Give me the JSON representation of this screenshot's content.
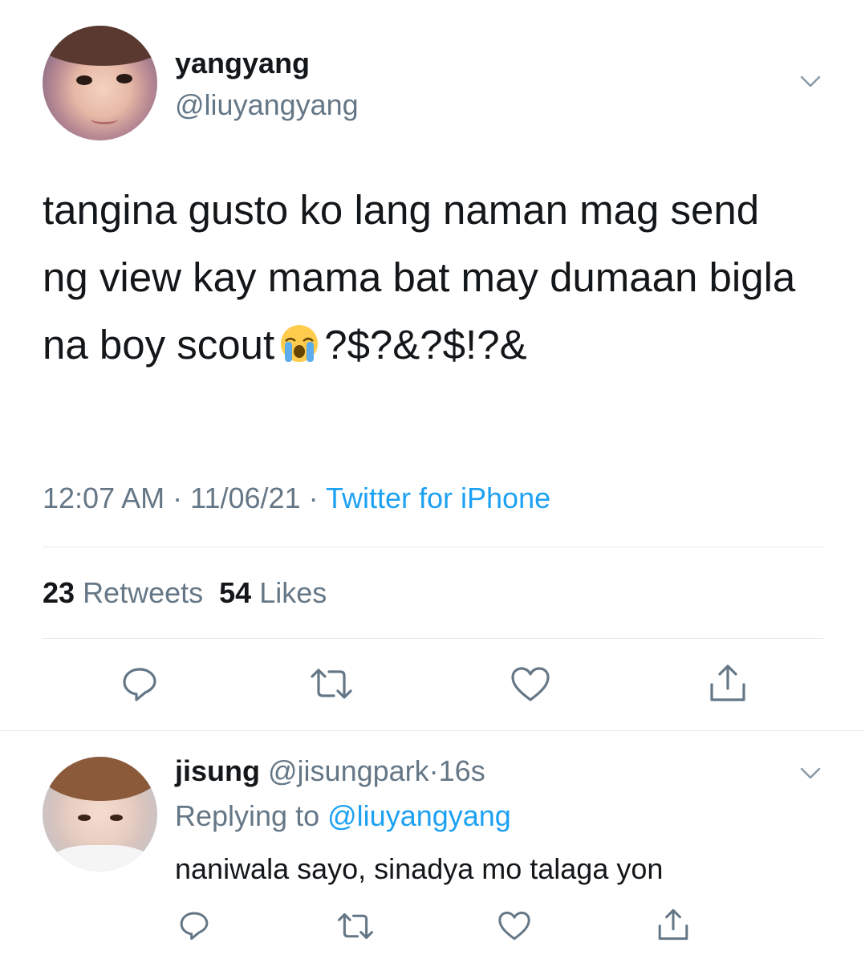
{
  "tweet": {
    "author": {
      "display_name": "yangyang",
      "handle": "@liuyangyang",
      "avatar": "profile-photo"
    },
    "text_before_emoji": "tangina gusto ko lang naman mag send ng view kay mama bat may dumaan bigla na boy scout",
    "emoji": "loudly-crying-face-emoji",
    "text_after_emoji": "?$?&?$!?&",
    "time": "12:07 AM",
    "separator": "·",
    "date": "11/06/21",
    "source": "Twitter for iPhone",
    "retweets_count": "23",
    "retweets_label": "Retweets",
    "likes_count": "54",
    "likes_label": "Likes",
    "actions": [
      "reply-icon",
      "retweet-icon",
      "like-icon",
      "share-icon"
    ]
  },
  "reply": {
    "author": {
      "display_name": "jisung",
      "handle": "@jisungpark",
      "avatar": "profile-photo"
    },
    "separator": "·",
    "time_ago": "16s",
    "replying_to_label": "Replying to",
    "replying_to_handle": "@liuyangyang",
    "text": "naniwala sayo, sinadya mo talaga yon",
    "actions": [
      "reply-icon",
      "retweet-icon",
      "like-icon",
      "share-icon"
    ]
  },
  "colors": {
    "text_primary": "#14171a",
    "text_secondary": "#657786",
    "link": "#1da1f2",
    "divider": "#e1e8ed",
    "icon": "#657786"
  }
}
